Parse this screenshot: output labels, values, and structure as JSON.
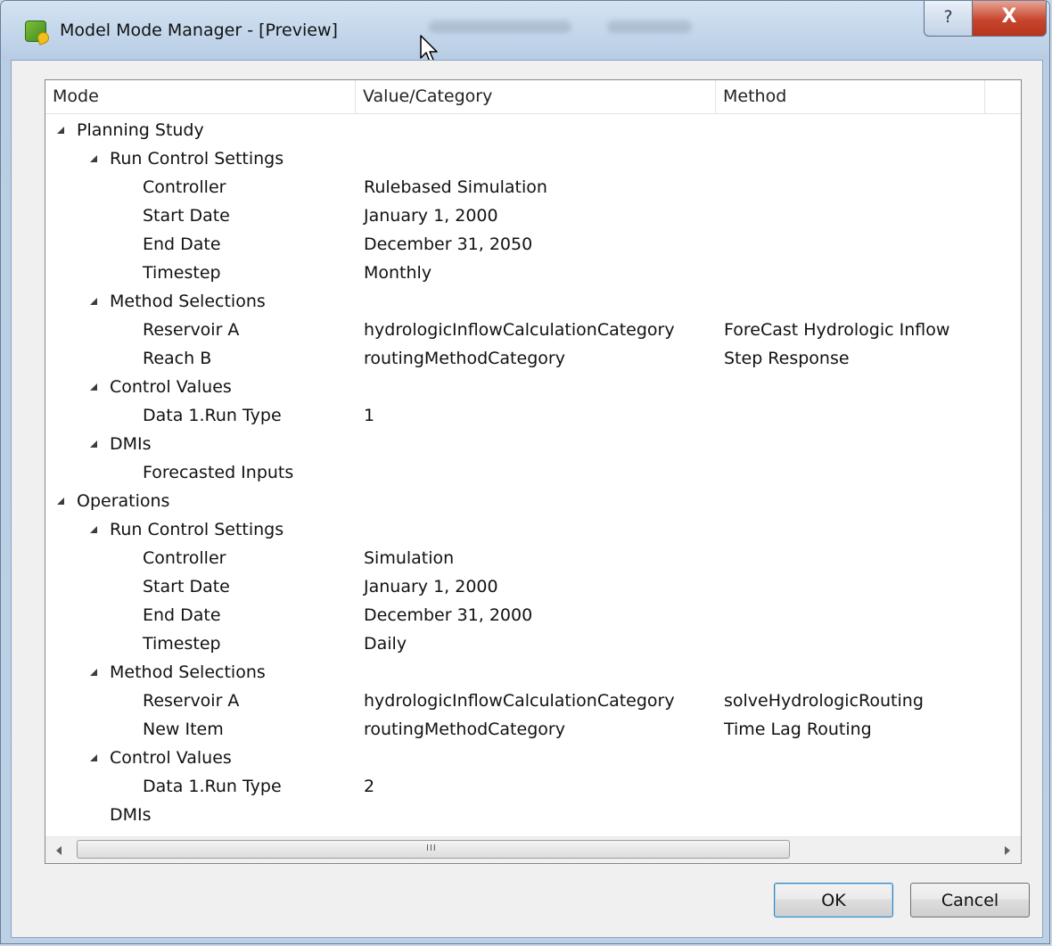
{
  "window": {
    "title": "Model Mode Manager - [Preview]",
    "help_label": "?",
    "close_label": "X"
  },
  "columns": [
    "Mode",
    "Value/Category",
    "Method"
  ],
  "tree_rows": [
    {
      "level": 0,
      "expanded": true,
      "label": "Planning Study",
      "value": "",
      "method": ""
    },
    {
      "level": 1,
      "expanded": true,
      "label": "Run Control Settings",
      "value": "",
      "method": ""
    },
    {
      "level": 2,
      "expanded": null,
      "label": "Controller",
      "value": "Rulebased Simulation",
      "method": ""
    },
    {
      "level": 2,
      "expanded": null,
      "label": "Start Date",
      "value": "January 1, 2000",
      "method": ""
    },
    {
      "level": 2,
      "expanded": null,
      "label": "End Date",
      "value": "December 31, 2050",
      "method": ""
    },
    {
      "level": 2,
      "expanded": null,
      "label": "Timestep",
      "value": "Monthly",
      "method": ""
    },
    {
      "level": 1,
      "expanded": true,
      "label": "Method Selections",
      "value": "",
      "method": ""
    },
    {
      "level": 2,
      "expanded": null,
      "label": "Reservoir A",
      "value": "hydrologicInflowCalculationCategory",
      "method": "ForeCast Hydrologic Inflow"
    },
    {
      "level": 2,
      "expanded": null,
      "label": "Reach B",
      "value": "routingMethodCategory",
      "method": "Step Response"
    },
    {
      "level": 1,
      "expanded": true,
      "label": "Control Values",
      "value": "",
      "method": ""
    },
    {
      "level": 2,
      "expanded": null,
      "label": "Data 1.Run Type",
      "value": "1",
      "method": ""
    },
    {
      "level": 1,
      "expanded": true,
      "label": "DMIs",
      "value": "",
      "method": ""
    },
    {
      "level": 2,
      "expanded": null,
      "label": "Forecasted Inputs",
      "value": "",
      "method": ""
    },
    {
      "level": 0,
      "expanded": true,
      "label": "Operations",
      "value": "",
      "method": ""
    },
    {
      "level": 1,
      "expanded": true,
      "label": "Run Control Settings",
      "value": "",
      "method": ""
    },
    {
      "level": 2,
      "expanded": null,
      "label": "Controller",
      "value": "Simulation",
      "method": ""
    },
    {
      "level": 2,
      "expanded": null,
      "label": "Start Date",
      "value": "January 1, 2000",
      "method": ""
    },
    {
      "level": 2,
      "expanded": null,
      "label": "End Date",
      "value": "December 31, 2000",
      "method": ""
    },
    {
      "level": 2,
      "expanded": null,
      "label": "Timestep",
      "value": "Daily",
      "method": ""
    },
    {
      "level": 1,
      "expanded": true,
      "label": "Method Selections",
      "value": "",
      "method": ""
    },
    {
      "level": 2,
      "expanded": null,
      "label": "Reservoir A",
      "value": "hydrologicInflowCalculationCategory",
      "method": "solveHydrologicRouting"
    },
    {
      "level": 2,
      "expanded": null,
      "label": "New Item",
      "value": "routingMethodCategory",
      "method": "Time Lag Routing"
    },
    {
      "level": 1,
      "expanded": true,
      "label": "Control Values",
      "value": "",
      "method": ""
    },
    {
      "level": 2,
      "expanded": null,
      "label": "Data 1.Run Type",
      "value": "2",
      "method": ""
    },
    {
      "level": 1,
      "expanded": null,
      "label": "DMIs",
      "value": "",
      "method": ""
    }
  ],
  "scrollbar": {
    "grip": "III"
  },
  "buttons": {
    "ok": "OK",
    "cancel": "Cancel"
  },
  "icons": {
    "app": "model-mode-manager-app-icon",
    "expand": "expanded-triangle-icon",
    "cursor": "mouse-pointer-icon"
  },
  "colors": {
    "titlebar": "#c6d8ec",
    "close_button": "#c8452d",
    "ok_border": "#3c7fb1"
  }
}
